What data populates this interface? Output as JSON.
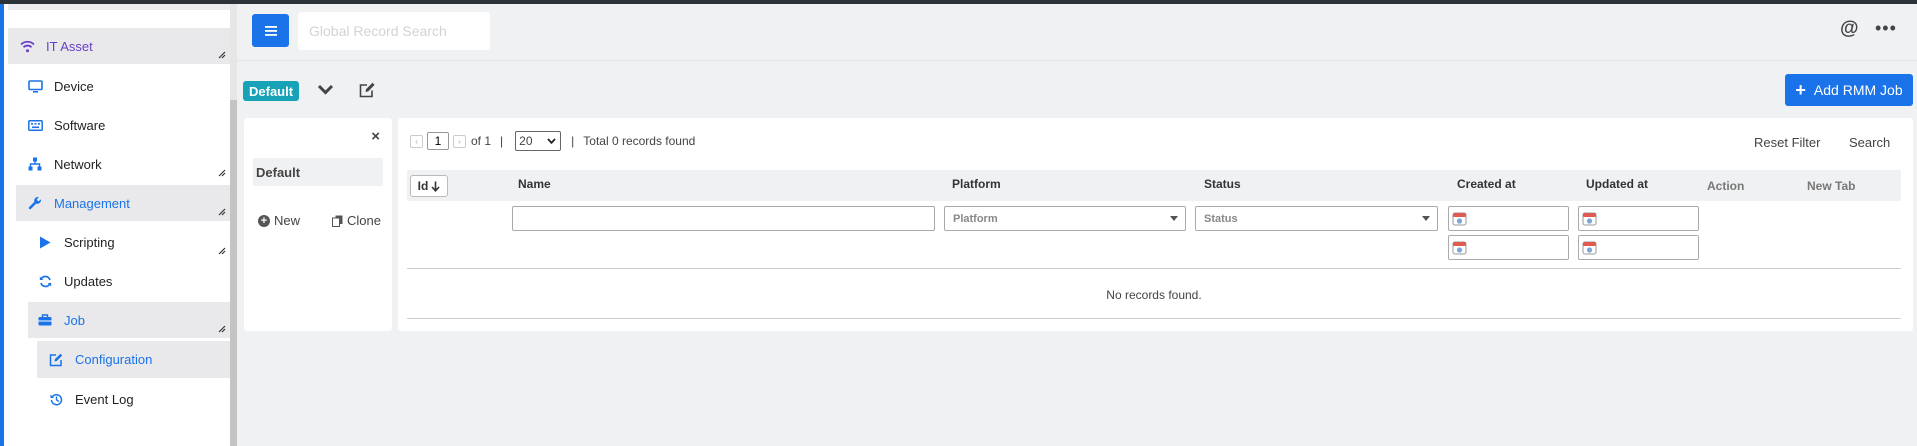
{
  "sidebar": {
    "items": [
      {
        "label": "IT Asset",
        "icon": "wifi-icon"
      },
      {
        "label": "Device",
        "icon": "monitor-icon"
      },
      {
        "label": "Software",
        "icon": "keyboard-icon"
      },
      {
        "label": "Network",
        "icon": "network-icon"
      },
      {
        "label": "Management",
        "icon": "wrench-icon"
      },
      {
        "label": "Scripting",
        "icon": "play-icon"
      },
      {
        "label": "Updates",
        "icon": "sync-icon"
      },
      {
        "label": "Job",
        "icon": "toolbox-icon"
      },
      {
        "label": "Configuration",
        "icon": "edit-icon"
      },
      {
        "label": "Event Log",
        "icon": "history-icon"
      }
    ]
  },
  "header": {
    "search_placeholder": "Global Record Search",
    "at_symbol": "@",
    "more_symbol": "•••"
  },
  "view_bar": {
    "view_badge": "Default",
    "add_button_label": "Add RMM Job",
    "add_button_symbol": "+"
  },
  "views_panel": {
    "close_symbol": "×",
    "default_view": "Default",
    "new_label": "New",
    "clone_label": "Clone"
  },
  "pager": {
    "prev_symbol": "‹",
    "next_symbol": "›",
    "current_page": "1",
    "of_text": "of 1",
    "separator": "|",
    "page_size": "20",
    "total_text": "Total 0 records found"
  },
  "toolbar": {
    "reset_filter": "Reset Filter",
    "search": "Search"
  },
  "table": {
    "columns": {
      "id": "Id",
      "name": "Name",
      "platform": "Platform",
      "status": "Status",
      "created_at": "Created at",
      "updated_at": "Updated at",
      "action": "Action",
      "new_tab": "New Tab"
    },
    "filters": {
      "platform_placeholder": "Platform",
      "status_placeholder": "Status"
    },
    "empty_message": "No records found."
  },
  "colors": {
    "primary": "#1a73e8",
    "badge": "#17a2b8",
    "it_asset": "#6a3fc2"
  }
}
